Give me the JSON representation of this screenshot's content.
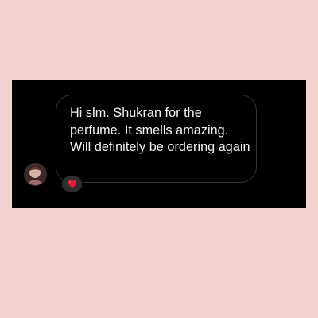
{
  "message": {
    "text": "Hi slm. Shukran for the perfume. It smells amazing. Will definitely be ordering again"
  },
  "reaction": {
    "icon": "heart-icon",
    "emoji": "❤️",
    "color": "#e21d3c"
  },
  "colors": {
    "background": "#f2d3d0",
    "panel": "#000000",
    "bubble_border": "#303030",
    "text": "#f4f4f4"
  },
  "avatar": {
    "icon": "profile-avatar"
  }
}
